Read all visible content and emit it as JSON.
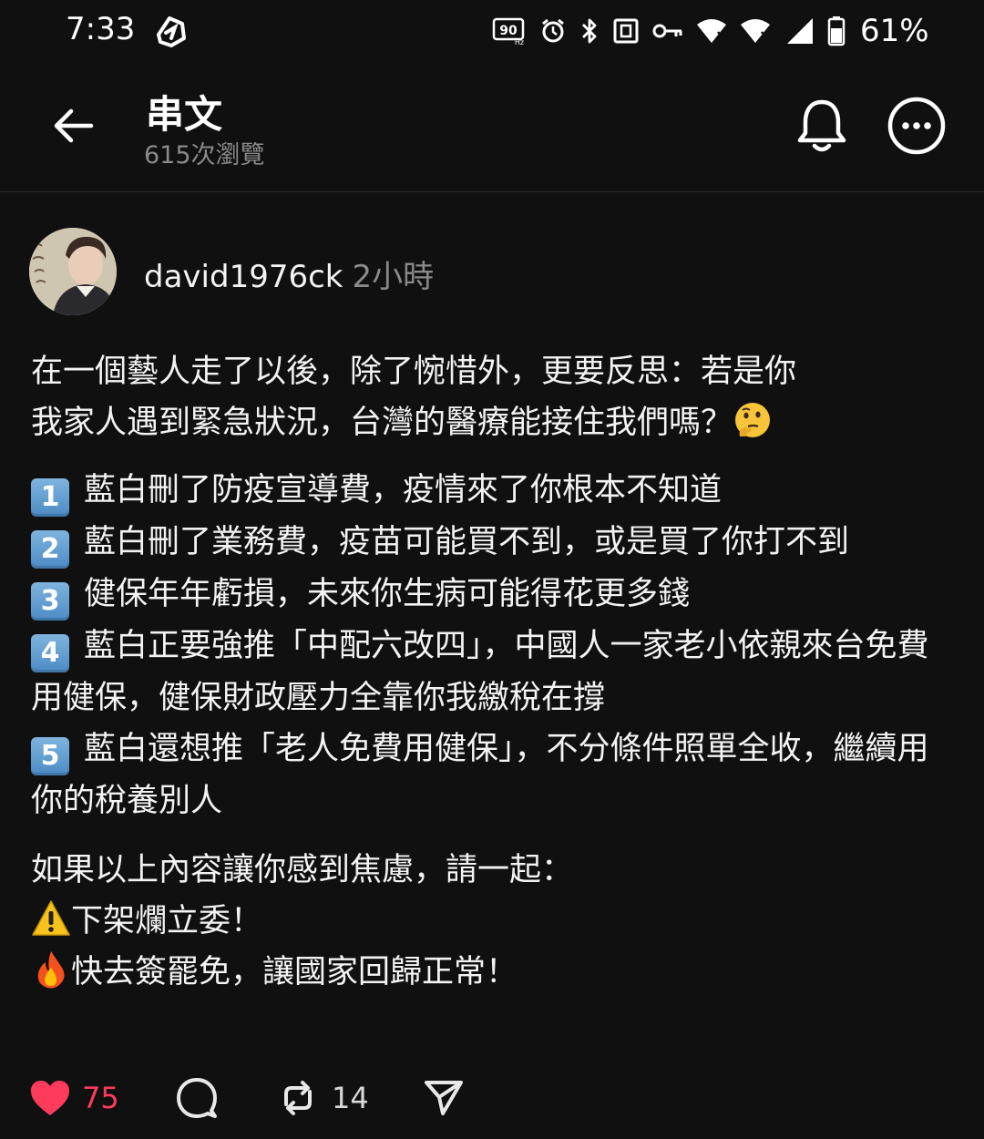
{
  "status_bar": {
    "time": "7:33",
    "battery": "61%",
    "refresh_rate_badge": "90",
    "icons": [
      "app-logo-icon",
      "refresh-rate-icon",
      "alarm-icon",
      "bluetooth-icon",
      "nfc-icon",
      "vpn-key-icon",
      "wifi-icon",
      "wifi-icon",
      "cell-signal-icon",
      "battery-icon"
    ]
  },
  "header": {
    "title": "串文",
    "views": "615次瀏覽"
  },
  "post": {
    "author": "david1976ck",
    "time": "2小時",
    "intro_line1": "在一個藝人走了以後，除了惋惜外，更要反思：若是你",
    "intro_line2": "我家人遇到緊急狀況，台灣的醫療能接住我們嗎？",
    "items": [
      {
        "num": "1",
        "text": "藍白刪了防疫宣導費，疫情來了你根本不知道"
      },
      {
        "num": "2",
        "text": "藍白刪了業務費，疫苗可能買不到，或是買了你打不到"
      },
      {
        "num": "3",
        "text": "健保年年虧損，未來你生病可能得花更多錢"
      },
      {
        "num": "4",
        "text": "藍白正要強推「中配六改四」，中國人一家老小依親來台免費用健保，健保財政壓力全靠你我繳稅在撐"
      },
      {
        "num": "5",
        "text": "藍白還想推「老人免費用健保」，不分條件照單全收，繼續用你的稅養別人"
      }
    ],
    "closing": "如果以上內容讓你感到焦慮，請一起：",
    "call1": "下架爛立委！",
    "call2": "快去簽罷免，讓國家回歸正常！"
  },
  "actions": {
    "likes": "75",
    "reposts": "14",
    "like_color": "#ff3b5c"
  }
}
